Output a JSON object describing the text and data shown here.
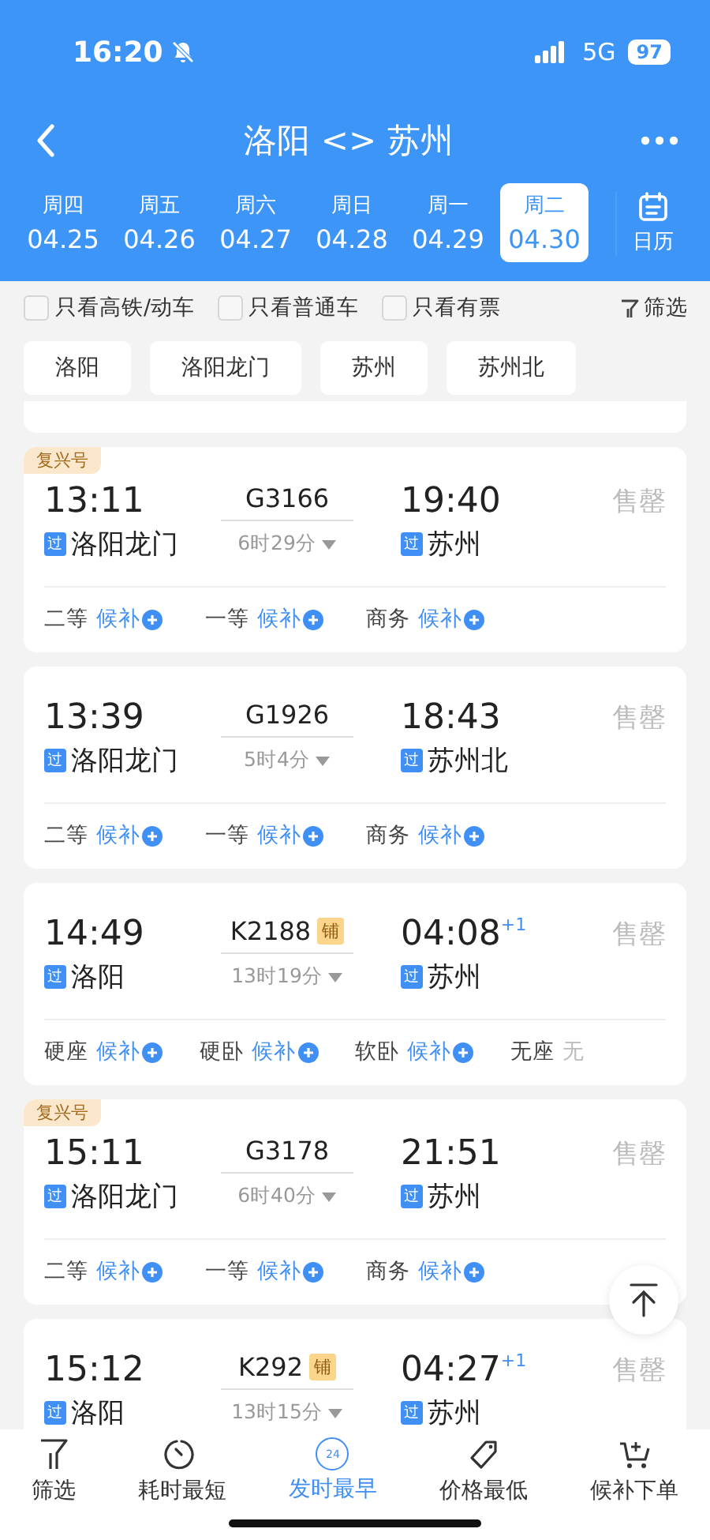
{
  "status_bar": {
    "time": "16:20",
    "network": "5G",
    "battery": "97"
  },
  "nav": {
    "title": "洛阳 <> 苏州"
  },
  "dates": [
    {
      "weekday": "周四",
      "date": "04.25",
      "selected": false
    },
    {
      "weekday": "周五",
      "date": "04.26",
      "selected": false
    },
    {
      "weekday": "周六",
      "date": "04.27",
      "selected": false
    },
    {
      "weekday": "周日",
      "date": "04.28",
      "selected": false
    },
    {
      "weekday": "周一",
      "date": "04.29",
      "selected": false
    },
    {
      "weekday": "周二",
      "date": "04.30",
      "selected": true
    }
  ],
  "calendar_button": {
    "label": "日历"
  },
  "filters": [
    {
      "label": "只看高铁/动车",
      "checked": false
    },
    {
      "label": "只看普通车",
      "checked": false
    },
    {
      "label": "只看有票",
      "checked": false
    }
  ],
  "filter_button": {
    "label": "筛选"
  },
  "stations": [
    {
      "label": "洛阳"
    },
    {
      "label": "洛阳龙门"
    },
    {
      "label": "苏州"
    },
    {
      "label": "苏州北"
    }
  ],
  "trains": [
    {
      "badge": "复兴号",
      "depart": "13:11",
      "train_no": "G3166",
      "arrive": "19:40",
      "status": "售罄",
      "from_tag": "过",
      "from": "洛阳龙门",
      "duration": "6时29分",
      "to_tag": "过",
      "to": "苏州",
      "seats": [
        {
          "class": "二等",
          "status": "候补",
          "kind": "waitlist"
        },
        {
          "class": "一等",
          "status": "候补",
          "kind": "waitlist"
        },
        {
          "class": "商务",
          "status": "候补",
          "kind": "waitlist"
        }
      ]
    },
    {
      "depart": "13:39",
      "train_no": "G1926",
      "arrive": "18:43",
      "status": "售罄",
      "from_tag": "过",
      "from": "洛阳龙门",
      "duration": "5时4分",
      "to_tag": "过",
      "to": "苏州北",
      "seats": [
        {
          "class": "二等",
          "status": "候补",
          "kind": "waitlist"
        },
        {
          "class": "一等",
          "status": "候补",
          "kind": "waitlist"
        },
        {
          "class": "商务",
          "status": "候补",
          "kind": "waitlist"
        }
      ]
    },
    {
      "depart": "14:49",
      "train_no": "K2188",
      "berth_tag": "铺",
      "arrive": "04:08",
      "day_offset": "+1",
      "status": "售罄",
      "from_tag": "过",
      "from": "洛阳",
      "duration": "13时19分",
      "to_tag": "过",
      "to": "苏州",
      "seats": [
        {
          "class": "硬座",
          "status": "候补",
          "kind": "waitlist"
        },
        {
          "class": "硬卧",
          "status": "候补",
          "kind": "waitlist"
        },
        {
          "class": "软卧",
          "status": "候补",
          "kind": "waitlist"
        },
        {
          "class": "无座",
          "status": "无",
          "kind": "none"
        }
      ]
    },
    {
      "badge": "复兴号",
      "depart": "15:11",
      "train_no": "G3178",
      "arrive": "21:51",
      "status": "售罄",
      "from_tag": "过",
      "from": "洛阳龙门",
      "duration": "6时40分",
      "to_tag": "过",
      "to": "苏州",
      "seats": [
        {
          "class": "二等",
          "status": "候补",
          "kind": "waitlist"
        },
        {
          "class": "一等",
          "status": "候补",
          "kind": "waitlist"
        },
        {
          "class": "商务",
          "status": "候补",
          "kind": "waitlist"
        }
      ]
    },
    {
      "depart": "15:12",
      "train_no": "K292",
      "berth_tag": "铺",
      "arrive": "04:27",
      "day_offset": "+1",
      "status": "售罄",
      "from_tag": "过",
      "from": "洛阳",
      "duration": "13时15分",
      "to_tag": "过",
      "to": "苏州"
    }
  ],
  "bottom_tabs": [
    {
      "label": "筛选",
      "selected": false
    },
    {
      "label": "耗时最短",
      "selected": false
    },
    {
      "label": "发时最早",
      "selected": true,
      "icon_text": "24"
    },
    {
      "label": "价格最低",
      "selected": false
    },
    {
      "label": "候补下单",
      "selected": false
    }
  ]
}
